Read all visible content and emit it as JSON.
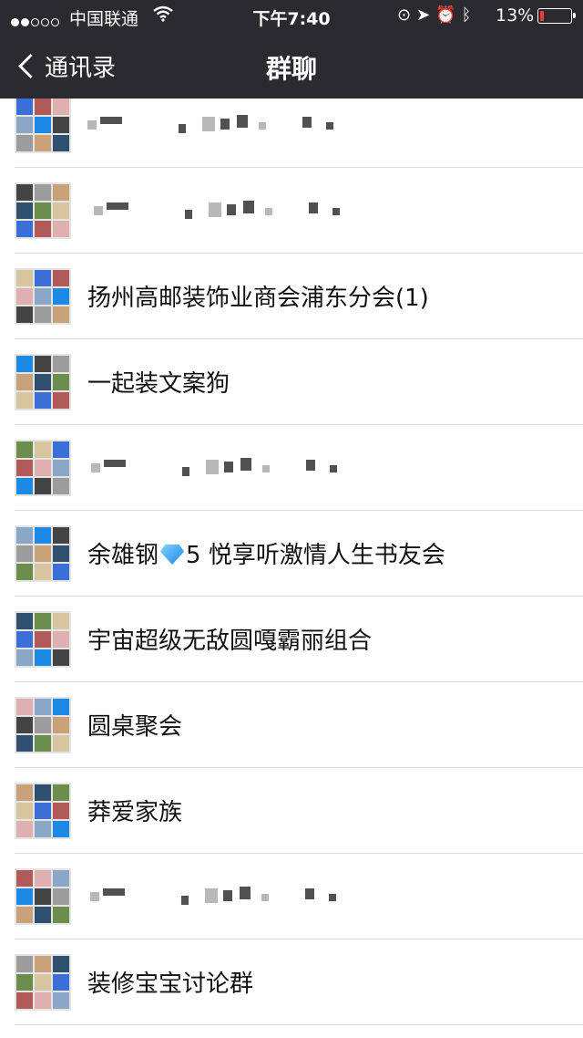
{
  "status_bar": {
    "carrier": "中国联通",
    "time": "下午7:40",
    "battery_percent": "13%",
    "battery_level": 0.13,
    "icons": [
      "signal-dots",
      "wifi-icon",
      "rotation-lock-icon",
      "location-arrow-icon",
      "alarm-icon",
      "bluetooth-icon",
      "battery-icon"
    ]
  },
  "nav": {
    "back_label": "通讯录",
    "title": "群聊"
  },
  "groups": [
    {
      "name": "",
      "obscured": true
    },
    {
      "name": "",
      "obscured": true
    },
    {
      "name": "扬州高邮装饰业商会浦东分会(1)",
      "obscured": false
    },
    {
      "name": "一起装文案狗",
      "obscured": false
    },
    {
      "name": "",
      "obscured": true
    },
    {
      "name_before": "余雄钢",
      "name_after": "5 悦享听激情人生书友会",
      "has_gem_icon": true,
      "obscured": false
    },
    {
      "name": "宇宙超级无敌圆嘎霸丽组合",
      "obscured": false
    },
    {
      "name": "圆桌聚会",
      "obscured": false
    },
    {
      "name": "莽爱家族",
      "obscured": false
    },
    {
      "name": "",
      "obscured": true
    },
    {
      "name": "装修宝宝讨论群",
      "obscured": false
    }
  ],
  "colors": {
    "nav_background": "#2b2b2f",
    "battery_low": "#ff3b30",
    "list_background": "#ffffff"
  }
}
